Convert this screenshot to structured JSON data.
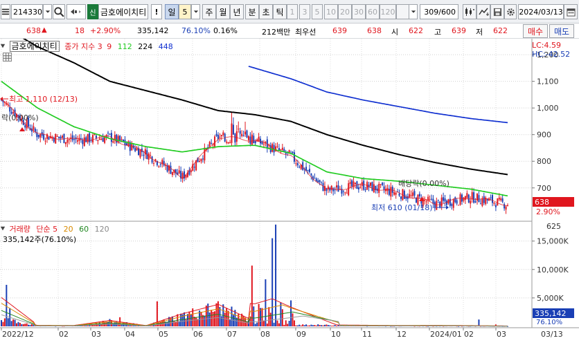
{
  "toolbar": {
    "code": "214330",
    "credit_badge": "신",
    "stock_name": "금호에이치티",
    "alert_mark": "!",
    "period_unit": "일",
    "period_value": "5",
    "periods": [
      "주",
      "월",
      "년",
      "분",
      "초",
      "틱"
    ],
    "intervals": [
      "1",
      "3",
      "5",
      "10",
      "20",
      "30",
      "60",
      "120"
    ],
    "count_display": "309/600",
    "date": "2024/03/13"
  },
  "quote": {
    "price": "638",
    "change_arrow": "▲",
    "change": "18",
    "change_rate": "+2.90%",
    "volume": "335,142",
    "volume_ratio": "76.10%",
    "turnover": "0.16%",
    "amount": "212백만",
    "priority_label": "최우선",
    "ask": "639",
    "bid": "638",
    "open_label": "시",
    "open": "622",
    "high_label": "고",
    "high": "639",
    "low_label": "저",
    "low": "622",
    "buy_label": "매수",
    "sell_label": "매도"
  },
  "price_legend": {
    "name": "금호에이치티",
    "ma_label": "종가 지수 3",
    "ma_periods": [
      "9",
      "112",
      "224",
      "448"
    ],
    "lc": "LC:4.59",
    "hc": "HC:-42.52"
  },
  "volume_legend": {
    "label": "거래량",
    "ma_label": "단순 5",
    "ma_periods": [
      "20",
      "60",
      "120"
    ],
    "value": "335,142주(76.10%)"
  },
  "annotations": {
    "high": "최고 1,110 (12/13)",
    "low": "최저 610 (01/18)",
    "ex_dividend_left": "락(0.00%)",
    "ex_dividend_right": "배당락(0.00%)"
  },
  "price_axis": {
    "ticks": [
      "1,200",
      "1,100",
      "1,000",
      "900",
      "800",
      "700"
    ],
    "current": "638",
    "current_rate": "2.90%",
    "next_tick": "625"
  },
  "volume_axis": {
    "ticks": [
      "15,000K",
      "10,000K",
      "5,000K"
    ],
    "current": "335,142",
    "current_ratio": "76.10%"
  },
  "date_axis": {
    "labels": [
      "2022/12",
      "02",
      "03",
      "04",
      "05",
      "06",
      "07",
      "08",
      "09",
      "10",
      "11",
      "12",
      "2024/01",
      "02",
      "03",
      "03/13"
    ]
  },
  "colors": {
    "up": "#e0161e",
    "down": "#1a3fb5",
    "ma9": "#e0161e",
    "ma112": "#22cc22",
    "ma224": "#000000",
    "ma448": "#1030d0"
  },
  "chart_data": [
    {
      "type": "line",
      "title": "금호에이치티",
      "ylim": [
        580,
        1260
      ],
      "x": [
        "2022/12",
        "2023/02",
        "2023/03",
        "2023/04",
        "2023/05",
        "2023/06",
        "2023/07",
        "2023/08",
        "2023/09",
        "2023/10",
        "2023/11",
        "2023/12",
        "2024/01",
        "2024/02",
        "2024/03"
      ],
      "series": [
        {
          "name": "종가",
          "values": [
            1030,
            900,
            880,
            890,
            830,
            740,
            890,
            880,
            820,
            690,
            710,
            680,
            640,
            665,
            638
          ]
        },
        {
          "name": "112",
          "values": [
            1100,
            1000,
            930,
            885,
            855,
            835,
            855,
            860,
            830,
            760,
            735,
            725,
            710,
            695,
            670
          ]
        },
        {
          "name": "224",
          "values": [
            1310,
            1230,
            1170,
            1100,
            1065,
            1030,
            990,
            975,
            950,
            900,
            860,
            825,
            795,
            770,
            750
          ]
        },
        {
          "name": "448",
          "values": [
            null,
            null,
            null,
            null,
            null,
            null,
            1190,
            1150,
            1110,
            1060,
            1030,
            1005,
            980,
            960,
            945
          ]
        }
      ]
    },
    {
      "type": "bar",
      "title": "거래량",
      "ylim": [
        0,
        18000
      ],
      "x": [
        "2022/12",
        "2023/02",
        "2023/03",
        "2023/04",
        "2023/05",
        "2023/06",
        "2023/07",
        "2023/08",
        "2023/09",
        "2023/10",
        "2023/11",
        "2023/12",
        "2024/01",
        "2024/02",
        "2024/03"
      ],
      "values": [
        7300,
        800,
        700,
        4800,
        600,
        10200,
        17900,
        4200,
        1800,
        1200,
        900,
        700,
        800,
        600,
        335
      ]
    }
  ]
}
